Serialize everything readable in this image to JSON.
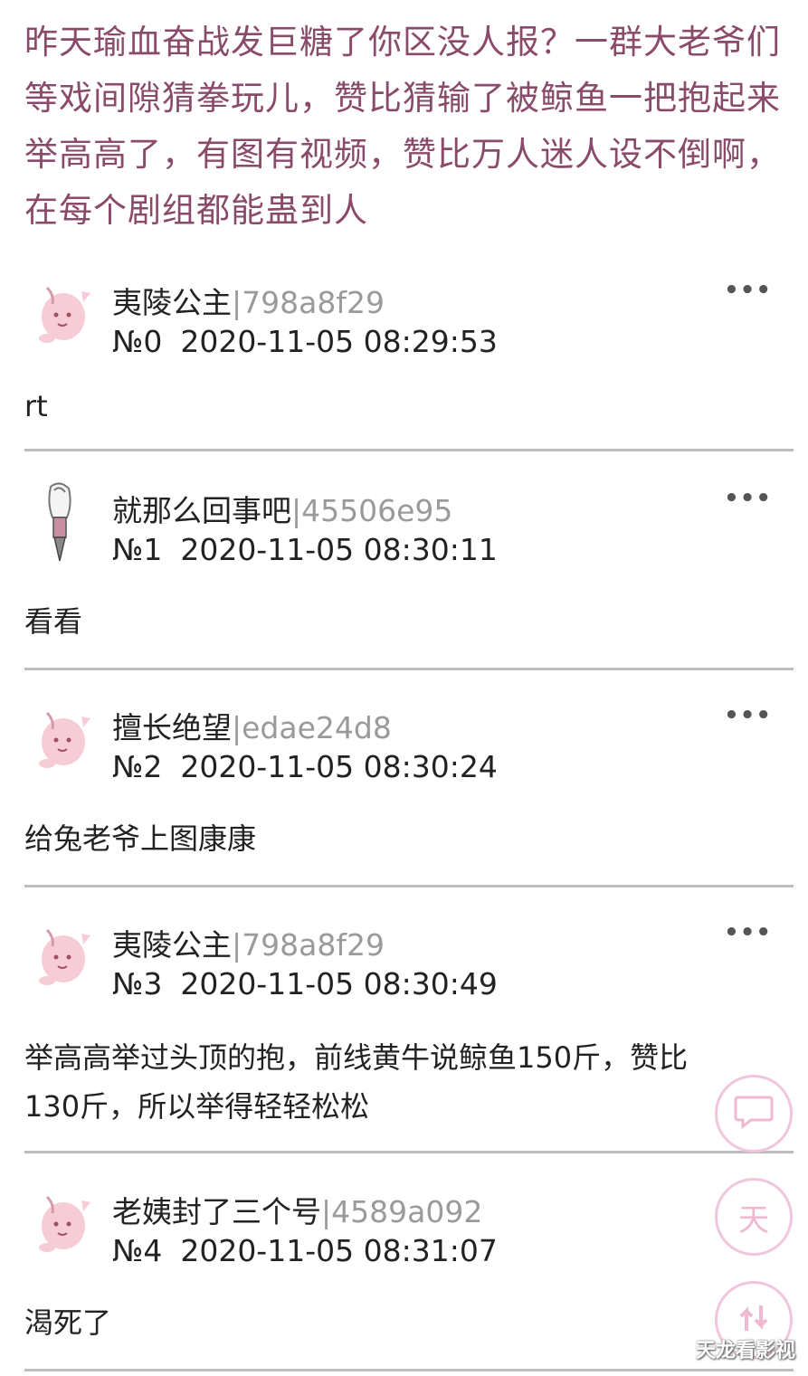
{
  "thread": {
    "title": "昨天瑜血奋战发巨糖了你区没人报？一群大老爷们等戏间隙猜拳玩儿，赞比猜输了被鲸鱼一把抱起来举高高了，有图有视频，赞比万人迷人设不倒啊，在每个剧组都能蛊到人"
  },
  "posts": [
    {
      "user": "夷陵公主",
      "hash": "798a8f29",
      "no": "№0",
      "time": "2020-11-05 08:29:53",
      "more": "•••",
      "content": "rt"
    },
    {
      "user": "就那么回事吧",
      "hash": "45506e95",
      "no": "№1",
      "time": "2020-11-05 08:30:11",
      "more": "•••",
      "content": "看看"
    },
    {
      "user": "擅长绝望",
      "hash": "edae24d8",
      "no": "№2",
      "time": "2020-11-05 08:30:24",
      "more": "•••",
      "content": "给兔老爷上图康康"
    },
    {
      "user": "夷陵公主",
      "hash": "798a8f29",
      "no": "№3",
      "time": "2020-11-05 08:30:49",
      "more": "•••",
      "content": "举高高举过头顶的抱，前线黄牛说鲸鱼150斤，赞比130斤，所以举得轻轻松松"
    },
    {
      "user": "老姨封了三个号",
      "hash": "4589a092",
      "no": "№4",
      "time": "2020-11-05 08:31:07",
      "more": "•••",
      "content": "渴死了"
    }
  ],
  "separator": "|",
  "fab": {
    "comment_icon": "comment-bubble-icon",
    "middle_label": "天",
    "scroll_icon": "swap-arrows-icon",
    "accent": "#f1c6dc"
  },
  "watermark": "天龙看影视"
}
